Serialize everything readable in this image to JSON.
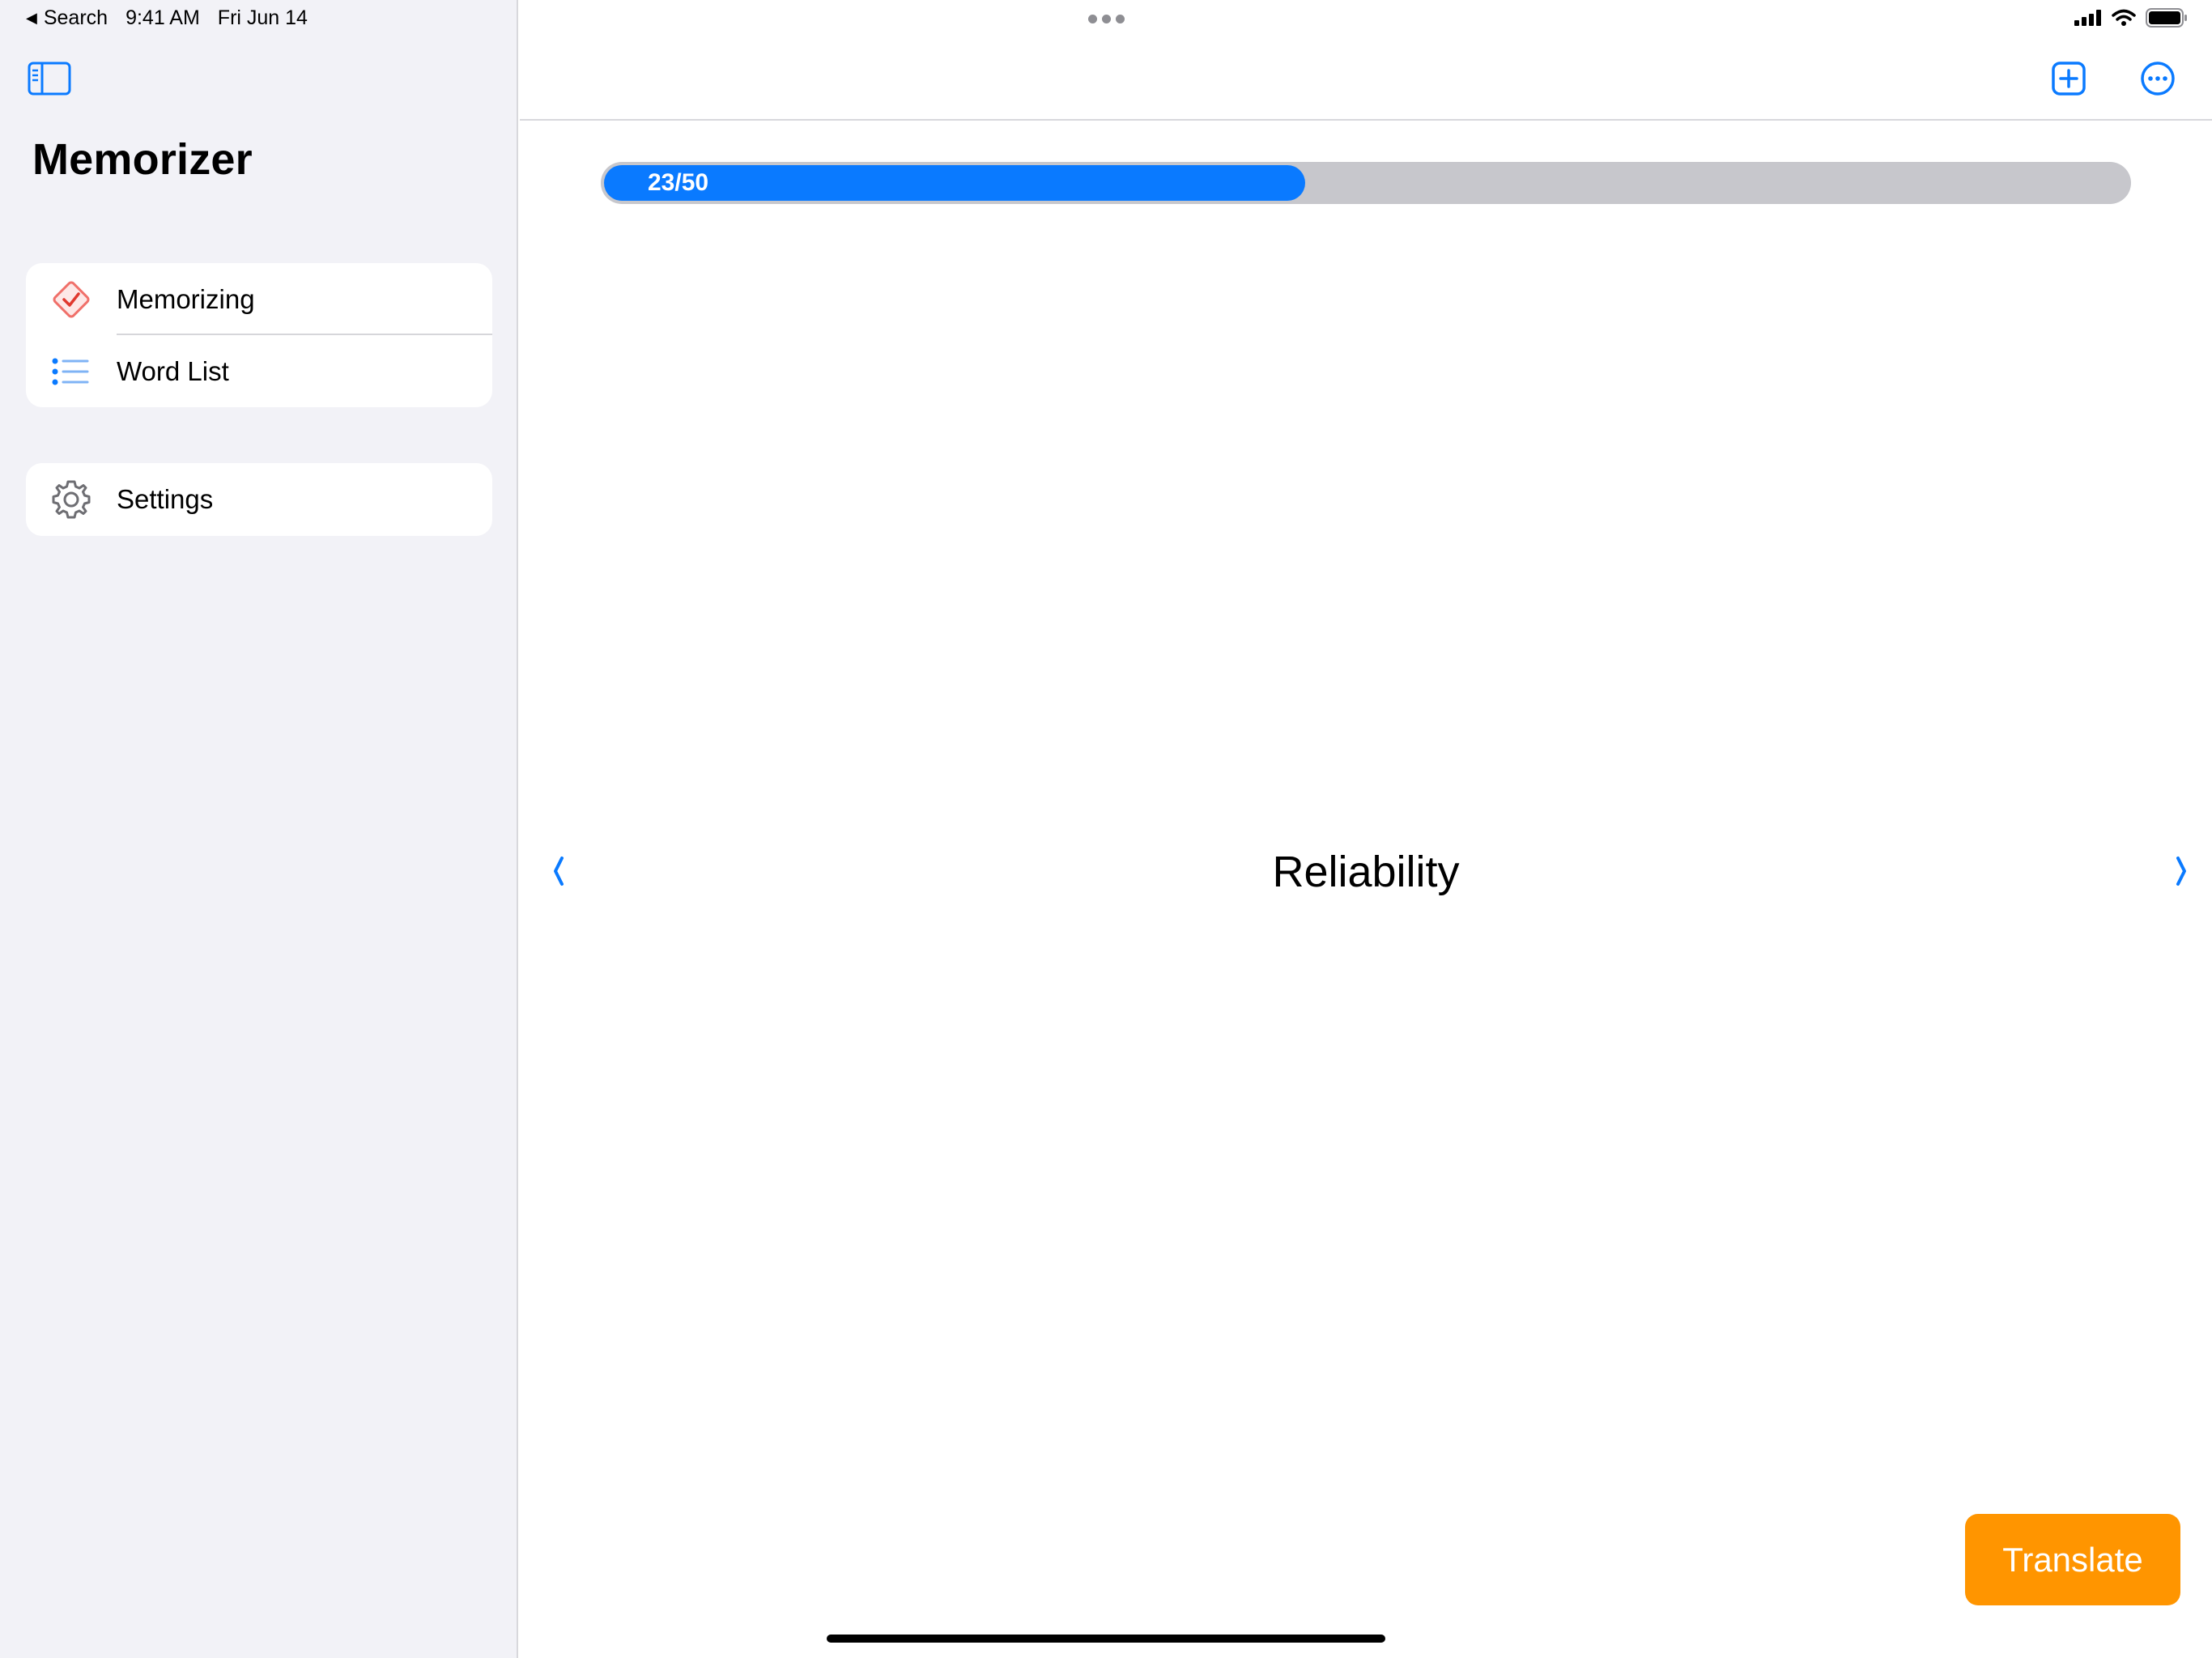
{
  "status_bar": {
    "back_label": "Search",
    "time": "9:41 AM",
    "date": "Fri Jun 14",
    "battery_percent": 100
  },
  "sidebar": {
    "title": "Memorizer",
    "items": [
      {
        "label": "Memorizing",
        "icon": "checkmark-diamond-icon"
      },
      {
        "label": "Word List",
        "icon": "list-bullet-icon"
      }
    ],
    "settings": {
      "label": "Settings",
      "icon": "gear-icon"
    }
  },
  "toolbar": {
    "add_icon": "plus-square-icon",
    "more_icon": "ellipsis-circle-icon"
  },
  "progress": {
    "label": "23/50",
    "current": 23,
    "total": 50
  },
  "card": {
    "word": "Reliability"
  },
  "actions": {
    "translate_label": "Translate"
  },
  "colors": {
    "accent": "#0a7aff",
    "translate": "#ff9500",
    "memorizing_icon": "#f0706a",
    "track": "#c7c7cc",
    "sidebar_bg": "#f2f2f7"
  }
}
